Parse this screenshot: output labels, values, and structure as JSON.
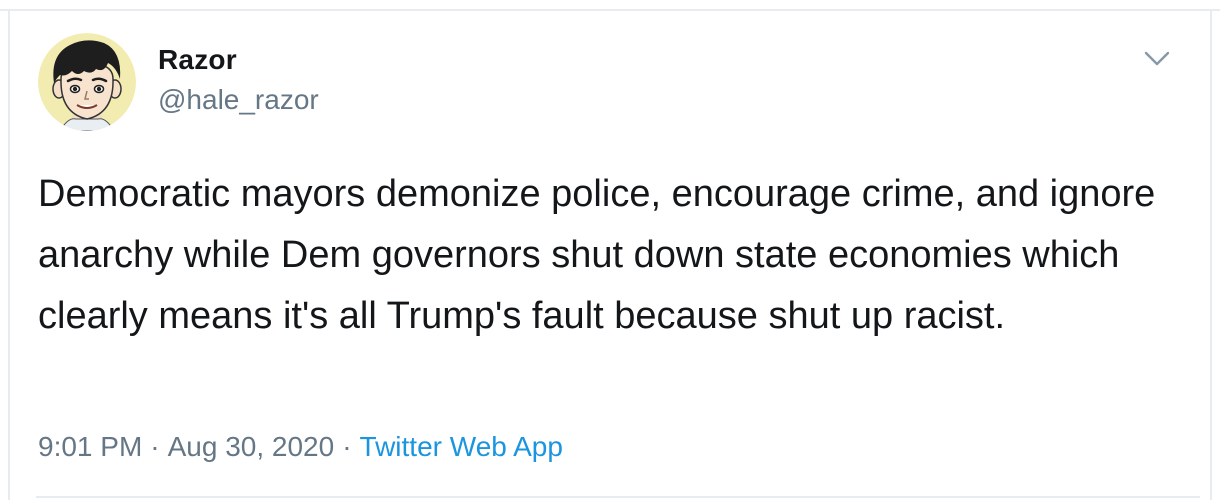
{
  "tweet": {
    "author_name": "Razor",
    "author_handle": "@hale_razor",
    "text": "Democratic mayors demonize police, encourage crime, and ignore anarchy while Dem governors shut down state economies which clearly means it's all Trump's fault because shut up racist.",
    "time": "9:01 PM",
    "separator": "·",
    "date": "Aug 30, 2020",
    "source": "Twitter Web App"
  },
  "icons": {
    "caret": "chevron-down-icon",
    "avatar": "cartoon-avatar"
  },
  "colors": {
    "text": "#14171a",
    "secondary": "#657786",
    "link": "#1b95e0",
    "border": "#e6ecf0"
  }
}
